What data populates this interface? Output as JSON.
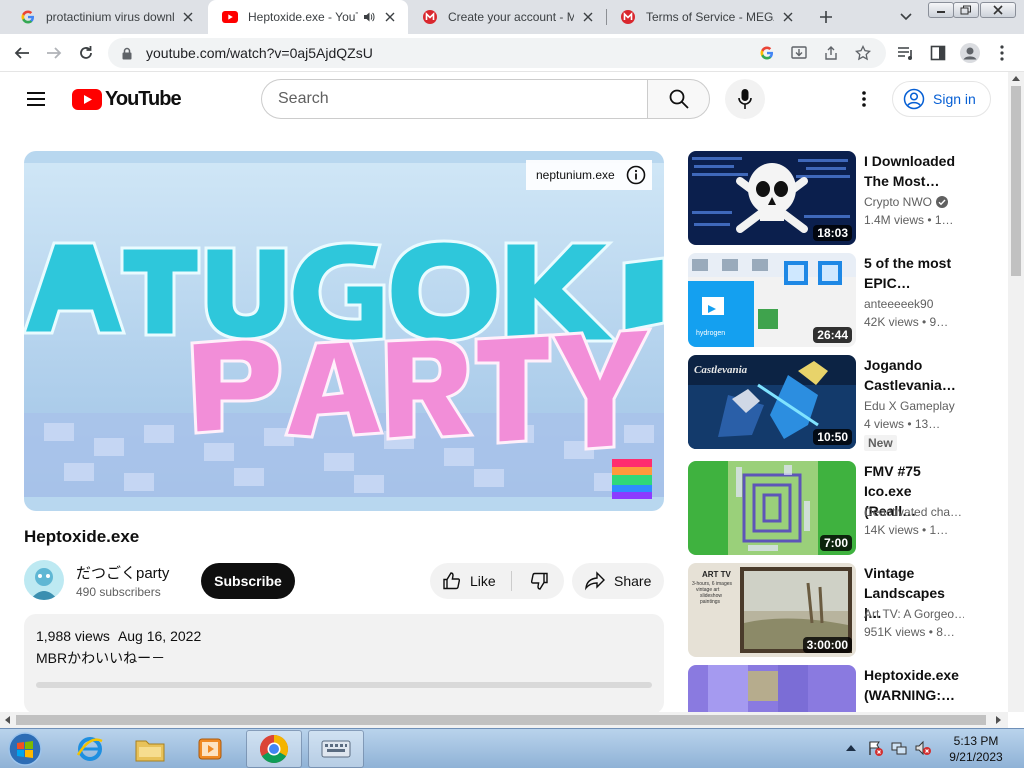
{
  "browser": {
    "tabs": [
      {
        "title": "protactinium virus downl",
        "favicon": "google-icon",
        "active": false
      },
      {
        "title": "Heptoxide.exe - YouT",
        "favicon": "youtube-icon",
        "active": true
      },
      {
        "title": "Create your account - ME",
        "favicon": "mega-icon",
        "active": false
      },
      {
        "title": "Terms of Service - MEGA",
        "favicon": "mega-icon",
        "active": false
      }
    ],
    "url": "youtube.com/watch?v=0aj5AjdQZsU"
  },
  "masthead": {
    "logo_text": "YouTube",
    "search_placeholder": "Search",
    "signin_label": "Sign in"
  },
  "video": {
    "overlay_label": "neptunium.exe",
    "title": "Heptoxide.exe",
    "channel": "だつごくparty",
    "subscribers": "490 subscribers",
    "subscribe_label": "Subscribe",
    "like_label": "Like",
    "share_label": "Share",
    "views": "1,988 views",
    "date": "Aug 16, 2022",
    "description": "MBRかわいいねー－"
  },
  "related": [
    {
      "title_line1": "I Downloaded",
      "title_line2": "The Most…",
      "channel": "Crypto NWO",
      "verified": true,
      "meta": "1.4M views  •  1…",
      "duration": "18:03",
      "badge": ""
    },
    {
      "title_line1": "5 of the most",
      "title_line2": "EPIC…",
      "channel": "anteeeeek90",
      "verified": false,
      "meta": "42K views  •  9…",
      "duration": "26:44",
      "badge": ""
    },
    {
      "title_line1": "Jogando",
      "title_line2": "Castlevania…",
      "channel": "Edu X Gameplay",
      "verified": false,
      "meta": "4 views  •  13…",
      "duration": "10:50",
      "badge": "New"
    },
    {
      "title_line1": "FMV #75",
      "title_line2": "Ico.exe (Reall…",
      "channel": "Deactivated cha…",
      "verified": false,
      "meta": "14K views  •  1…",
      "duration": "7:00",
      "badge": ""
    },
    {
      "title_line1": "Vintage",
      "title_line2": "Landscapes |…",
      "channel": "Art TV: A Gorgeo…",
      "verified": false,
      "meta": "951K views  •  8…",
      "duration": "3:00:00",
      "badge": ""
    },
    {
      "title_line1": "Heptoxide.exe",
      "title_line2": "(WARNING:…",
      "channel": "",
      "verified": false,
      "meta": "",
      "duration": "",
      "badge": ""
    }
  ],
  "thumb_text": {
    "artv_line1": "ART TV",
    "artv_line2": "3-hours, 6 images",
    "artv_line3": "vintage art",
    "artv_line4": "slideshow",
    "artv_line5": "paintings",
    "hydrogen": "hydrogen",
    "castlevania": "Castlevania"
  },
  "taskbar": {
    "time": "5:13 PM",
    "date": "9/21/2023"
  },
  "colors": {
    "youtube_red": "#ff0000",
    "link_blue": "#065fd4",
    "mega_red": "#d9272e"
  }
}
